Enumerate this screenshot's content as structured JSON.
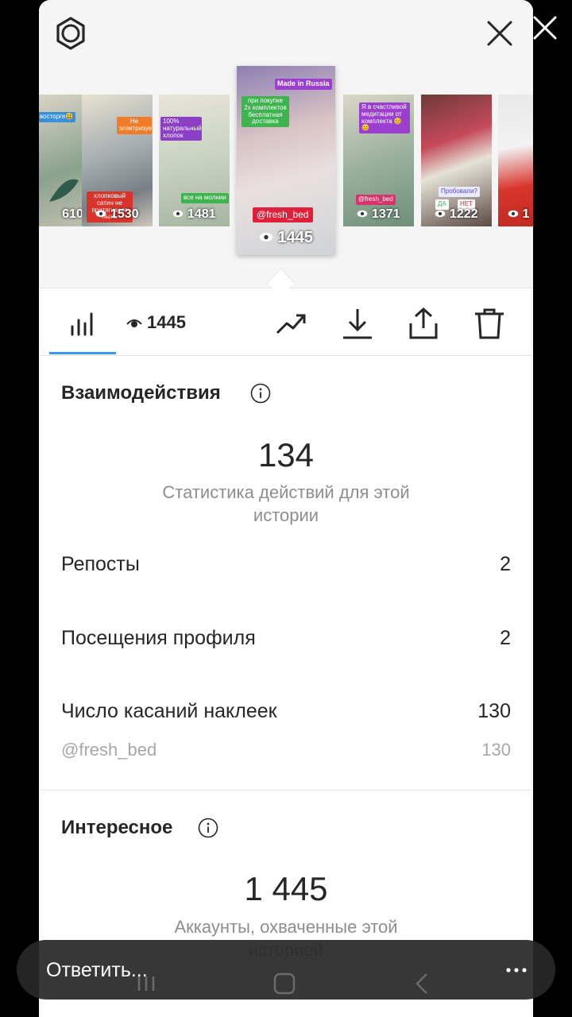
{
  "stories": [
    {
      "count": "610",
      "tags": [
        "восторге😃"
      ]
    },
    {
      "count": "1530",
      "tags": [
        "Не электризуется",
        "хлопковый сатин не притягивает пыль"
      ]
    },
    {
      "count": "1481",
      "tags": [
        "100% натуральный хлопок",
        "все на молнии"
      ]
    },
    {
      "count": "1445",
      "selected": true,
      "tags": [
        "Made in Russia",
        "при покупке 2х комплектов бесплатная доставка",
        "@fresh_bed"
      ]
    },
    {
      "count": "1371",
      "tags": [
        "Я в счастливой медитации от комплекта 😊😊",
        "@fresh_bed"
      ]
    },
    {
      "count": "1222",
      "tags": [
        "Пробовали?",
        "ДА",
        "НЕТ"
      ]
    },
    {
      "count": "1",
      "tags": []
    }
  ],
  "toolbar": {
    "views": "1445",
    "icons": [
      "bar-chart-icon",
      "eye-icon",
      "trending-icon",
      "download-icon",
      "share-icon",
      "trash-icon"
    ],
    "accent": "#3897f0"
  },
  "interactions": {
    "title": "Взаимодействия",
    "total": "134",
    "description": "Статистика действий для этой истории",
    "rows": [
      {
        "label": "Репосты",
        "value": "2"
      },
      {
        "label": "Посещения профиля",
        "value": "2"
      },
      {
        "label": "Число касаний наклеек",
        "value": "130"
      }
    ],
    "sub": {
      "label": "@fresh_bed",
      "value": "130"
    }
  },
  "discovery": {
    "title": "Интересное",
    "total": "1 445",
    "description": "Аккаунты, охваченные этой историей"
  },
  "reply": {
    "placeholder": "Ответить..."
  }
}
